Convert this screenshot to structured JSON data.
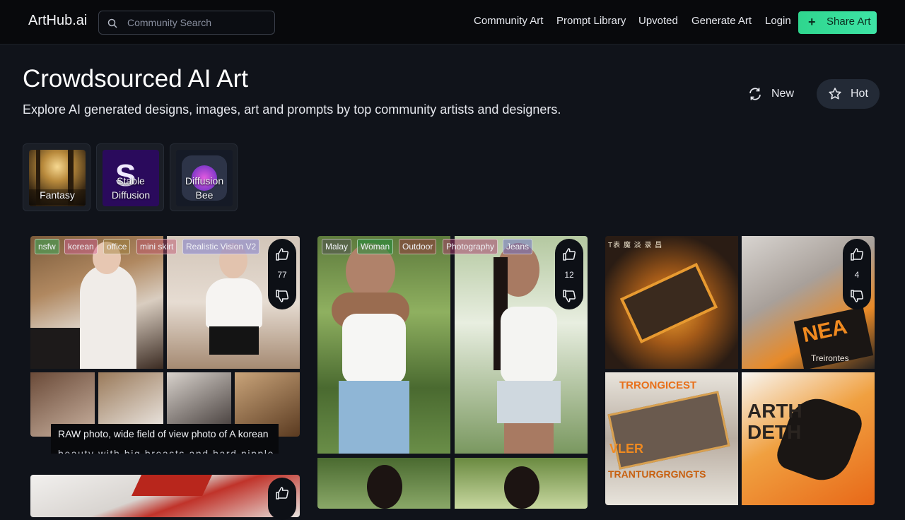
{
  "header": {
    "logo": "ArtHub.ai",
    "search_placeholder": "Community Search",
    "nav": [
      "Community Art",
      "Prompt Library",
      "Upvoted",
      "Generate Art",
      "Login"
    ],
    "share_label": "Share Art",
    "share_plus": "+"
  },
  "hero": {
    "title": "Crowdsourced AI Art",
    "subtitle": "Explore AI generated designs, images, art and prompts by top community artists and designers."
  },
  "sort": {
    "new_label": "New",
    "hot_label": "Hot",
    "active": "Hot"
  },
  "categories": [
    {
      "label_line1": "Fantasy",
      "label_line2": ""
    },
    {
      "label_line1": "Stable",
      "label_line2": "Diffusion"
    },
    {
      "label_line1": "Diffusion",
      "label_line2": "Bee"
    }
  ],
  "posts": [
    {
      "tags": [
        "nsfw",
        "korean",
        "office",
        "mini skirt",
        "Realistic Vision V2"
      ],
      "votes": "77",
      "prompt_line1": "RAW photo, wide field of view photo of A korean",
      "prompt_line2": "beauty with big breasts and hard nipple and"
    },
    {
      "tags": [
        "Malay",
        "Woman",
        "Outdoor",
        "Photography",
        "Jeans"
      ],
      "votes": "12"
    },
    {
      "tags": [],
      "votes": "4",
      "art_text": [
        "TRRONGICEST",
        "TRANTURGRGNGTS",
        "NEA",
        "Treirontes",
        "VLER",
        "ARTH DETH"
      ]
    }
  ],
  "colors": {
    "accent": "#2fd68e",
    "bg": "#10131a",
    "header_bg": "#08090c"
  }
}
